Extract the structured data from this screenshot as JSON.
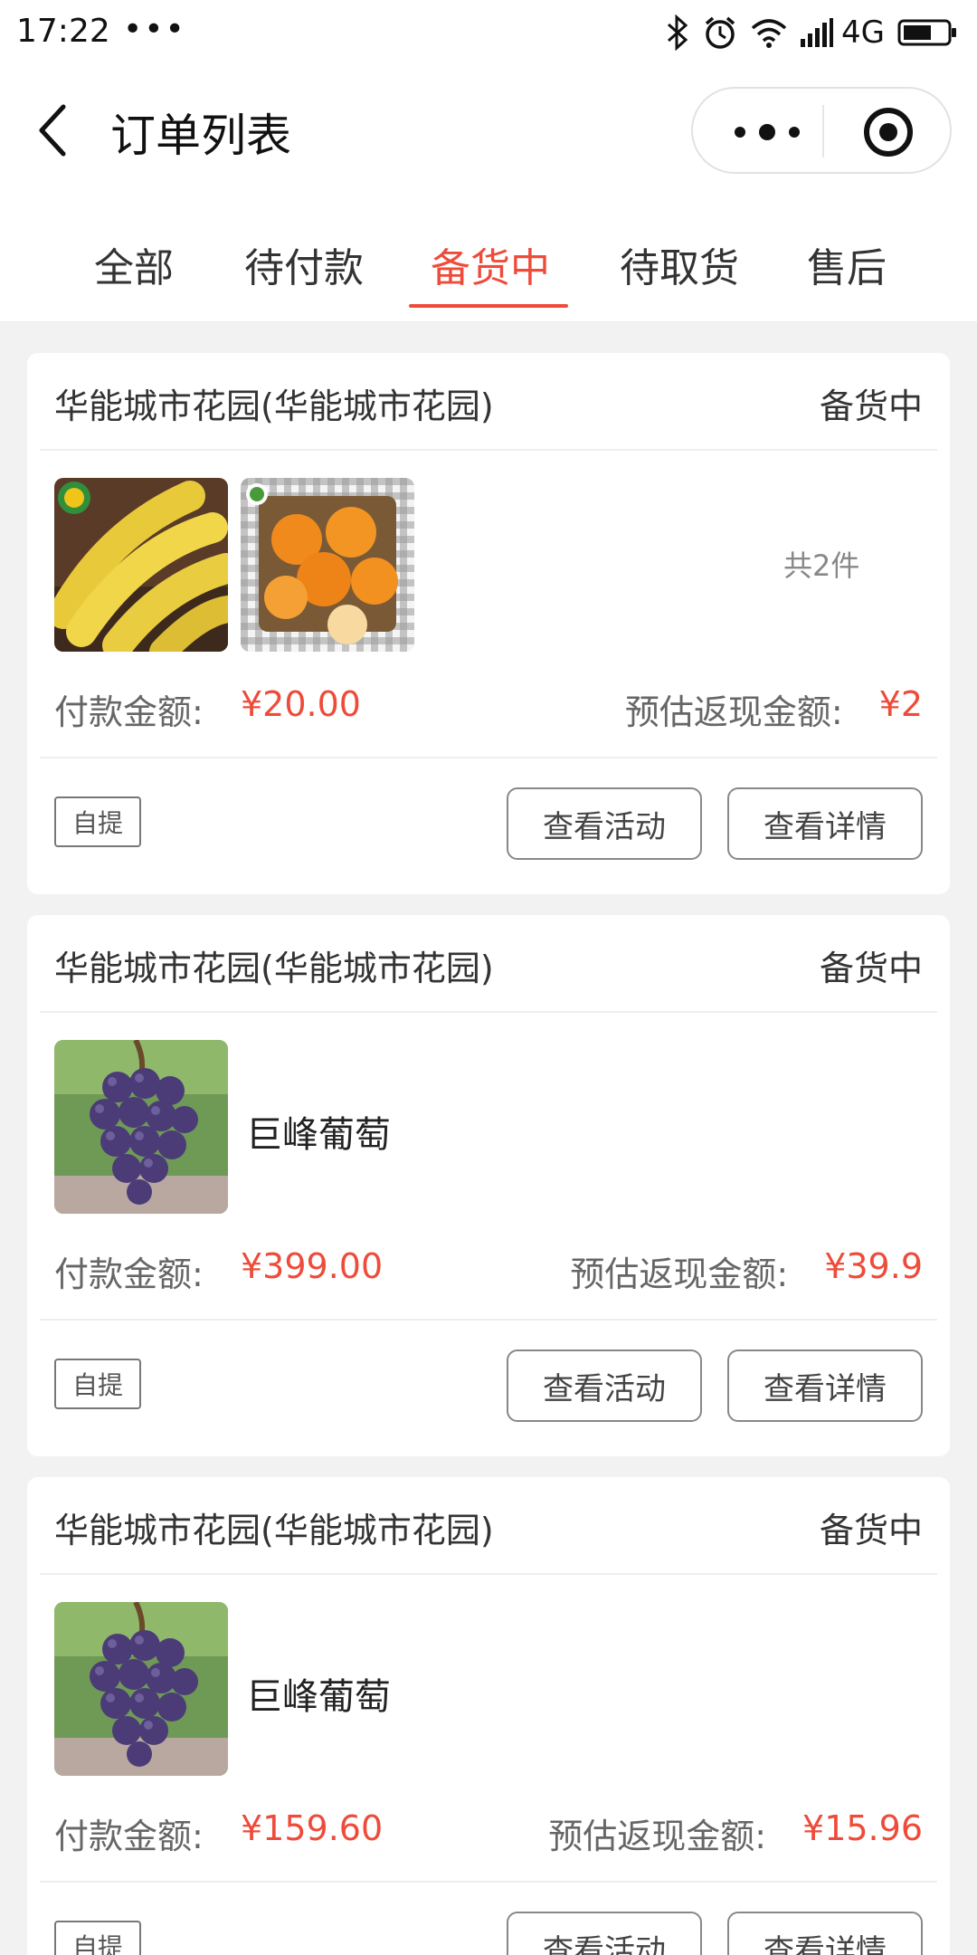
{
  "status_bar": {
    "time": "17:22",
    "dots": "•••",
    "network": "4G"
  },
  "header": {
    "title": "订单列表"
  },
  "tabs": [
    {
      "label": "全部"
    },
    {
      "label": "待付款"
    },
    {
      "label": "备货中"
    },
    {
      "label": "待取货"
    },
    {
      "label": "售后"
    }
  ],
  "active_tab": "备货中",
  "colors": {
    "accent": "#ef4b3a",
    "background": "#f2f2f2"
  },
  "labels": {
    "pay": "付款金额:",
    "cashback": "预估返现金额:",
    "pickup": "自提",
    "view_activity": "查看活动",
    "view_detail": "查看详情"
  },
  "orders": [
    {
      "store": "华能城市花园(华能城市花园)",
      "status": "备货中",
      "products": [
        "banana",
        "mandarin"
      ],
      "count": "共2件",
      "product_name": "",
      "pay": "¥20.00",
      "cashback": "¥2"
    },
    {
      "store": "华能城市花园(华能城市花园)",
      "status": "备货中",
      "products": [
        "grape"
      ],
      "count": "",
      "product_name": "巨峰葡萄",
      "pay": "¥399.00",
      "cashback": "¥39.9"
    },
    {
      "store": "华能城市花园(华能城市花园)",
      "status": "备货中",
      "products": [
        "grape"
      ],
      "count": "",
      "product_name": "巨峰葡萄",
      "pay": "¥159.60",
      "cashback": "¥15.96"
    }
  ]
}
